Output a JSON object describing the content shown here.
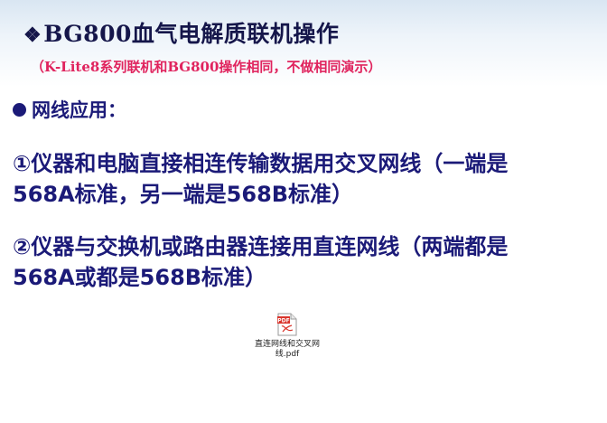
{
  "slide": {
    "title_marker": "❖",
    "title": "BG800血气电解质联机操作",
    "subtitle": "（K-Lite8系列联机和BG800操作相同，不做相同演示）",
    "section_heading": "网线应用：",
    "paragraph1": {
      "line1": "①仪器和电脑直接相连传输数据用交叉网线（一端是",
      "line2": "568A标准，另一端是568B标准）"
    },
    "paragraph2": {
      "line1": "②仪器与交换机或路由器连接用直连网线（两端都是",
      "line2": "568A或都是568B标准）"
    },
    "attachment": {
      "icon": "pdf-file-icon",
      "icon_label": "PDF",
      "name_line1": "直连网线和交叉网",
      "name_line2": "线.pdf"
    }
  },
  "colors": {
    "title": "#15164a",
    "subtitle": "#e0245e",
    "body_text": "#1b1a78",
    "pdf_red": "#d9342b"
  }
}
